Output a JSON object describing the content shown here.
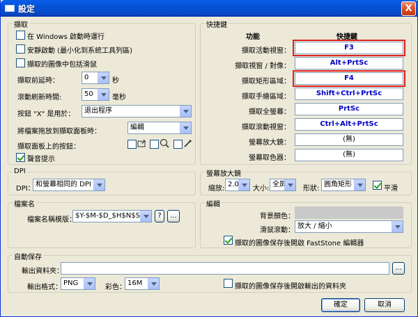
{
  "window": {
    "title": "設定",
    "close_glyph": "X"
  },
  "capture": {
    "group_label": "擷取",
    "run_on_startup": {
      "label": "在 Windows 啟動時運行",
      "checked": false
    },
    "silent_start": {
      "label": "安靜啟動 (最小化到系統工具列區)",
      "checked": false
    },
    "include_cursor": {
      "label": "擷取的圖像中包括滑鼠",
      "checked": false
    },
    "delay": {
      "label": "擷取前延時：",
      "value": "0",
      "unit": "秒"
    },
    "scroll_refresh": {
      "label": "滾動刷新時間:",
      "value": "50",
      "unit": "毫秒"
    },
    "x_button": {
      "label": "按鈕 \"X\" 是用於：",
      "value": "退出程序"
    },
    "drag_file": {
      "label": "將檔案拖放到擷取面板時：",
      "value": "編輯"
    },
    "panel_buttons": {
      "label": "擷取面板上的按鈕："
    },
    "sound": {
      "label": "聲音提示",
      "checked": true
    }
  },
  "hotkeys": {
    "group_label": "快捷鍵",
    "header_function": "功能",
    "header_key": "快捷鍵",
    "rows": [
      {
        "label": "擷取活動視窗：",
        "key": "F3",
        "highlight": true
      },
      {
        "label": "擷取視窗 / 對像：",
        "key": "Alt+PrtSc",
        "highlight": false
      },
      {
        "label": "擷取矩形區域：",
        "key": "F4",
        "highlight": true
      },
      {
        "label": "擷取手繪區域：",
        "key": "Shift+Ctrl+PrtSc",
        "highlight": false
      },
      {
        "label": "擷取全螢幕：",
        "key": "PrtSc",
        "highlight": false
      },
      {
        "label": "擷取滾動視窗：",
        "key": "Ctrl+Alt+PrtSc",
        "highlight": false
      },
      {
        "label": "螢幕放大鏡：",
        "key": "(無)",
        "highlight": false
      },
      {
        "label": "螢幕取色器：",
        "key": "(無)",
        "highlight": false
      }
    ]
  },
  "dpi": {
    "group_label": "DPI",
    "label": "DPI：",
    "value": "和螢幕相同的 DPI"
  },
  "magnifier": {
    "group_label": "螢幕放大鏡",
    "zoom_label": "縮放:",
    "zoom_value": "2.0",
    "size_label": "大小:",
    "size_value": "全屏",
    "shape_label": "形狀:",
    "shape_value": "圓角矩形",
    "smooth": {
      "label": "平滑",
      "checked": true
    }
  },
  "filename": {
    "group_label": "檔案名",
    "template_label": "檔案名稱模版：",
    "template_value": "$Y-$M-$D_$H$N$S",
    "help_label": "?",
    "more_label": "..."
  },
  "edit": {
    "group_label": "編輯",
    "bg_color_label": "背景顏色：",
    "wheel_label": "滑鼠滾動：",
    "wheel_value": "放大 / 縮小",
    "open_editor": {
      "label": "擷取的圖像保存後開啟 FastStone 編輯器",
      "checked": true
    }
  },
  "autosave": {
    "group_label": "自動保存",
    "folder_label": "輸出資料夾：",
    "folder_value": "",
    "browse_label": "...",
    "format_label": "輸出格式：",
    "format_value": "PNG",
    "color_label": "彩色：",
    "color_value": "16M",
    "open_folder": {
      "label": "擷取的圖像保存後開啟輸出的資料夾",
      "checked": false
    }
  },
  "footer": {
    "ok_label": "確定",
    "cancel_label": "取消"
  }
}
